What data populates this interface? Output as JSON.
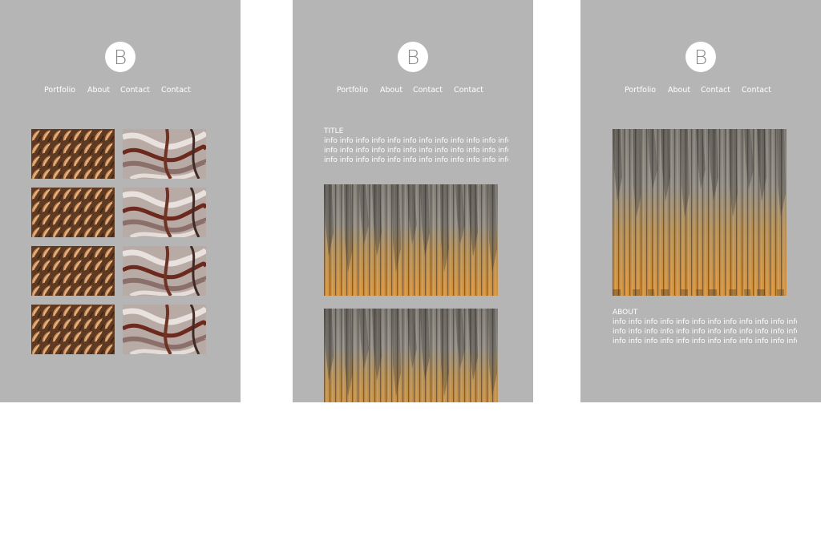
{
  "logo_letter": "B",
  "nav": [
    "Portfolio",
    "About",
    "Contact",
    "Contact"
  ],
  "detail": {
    "title": "TITLE",
    "info_lines": [
      "info info info info info info info info info info info info",
      "info info info info info info info info info info info info",
      "info info info info info info info info info info info info"
    ]
  },
  "about": {
    "title": "ABOUT",
    "info_lines": [
      "info info info info info info info info info info info info",
      "info info info info info info info info info info info info",
      "info info info info info info info info info info info info"
    ]
  },
  "colors": {
    "panel_bg": "#b5b5b5",
    "page_bg": "#ffffff",
    "text": "#ffffff",
    "logo_letter": "#8a8a8a"
  }
}
